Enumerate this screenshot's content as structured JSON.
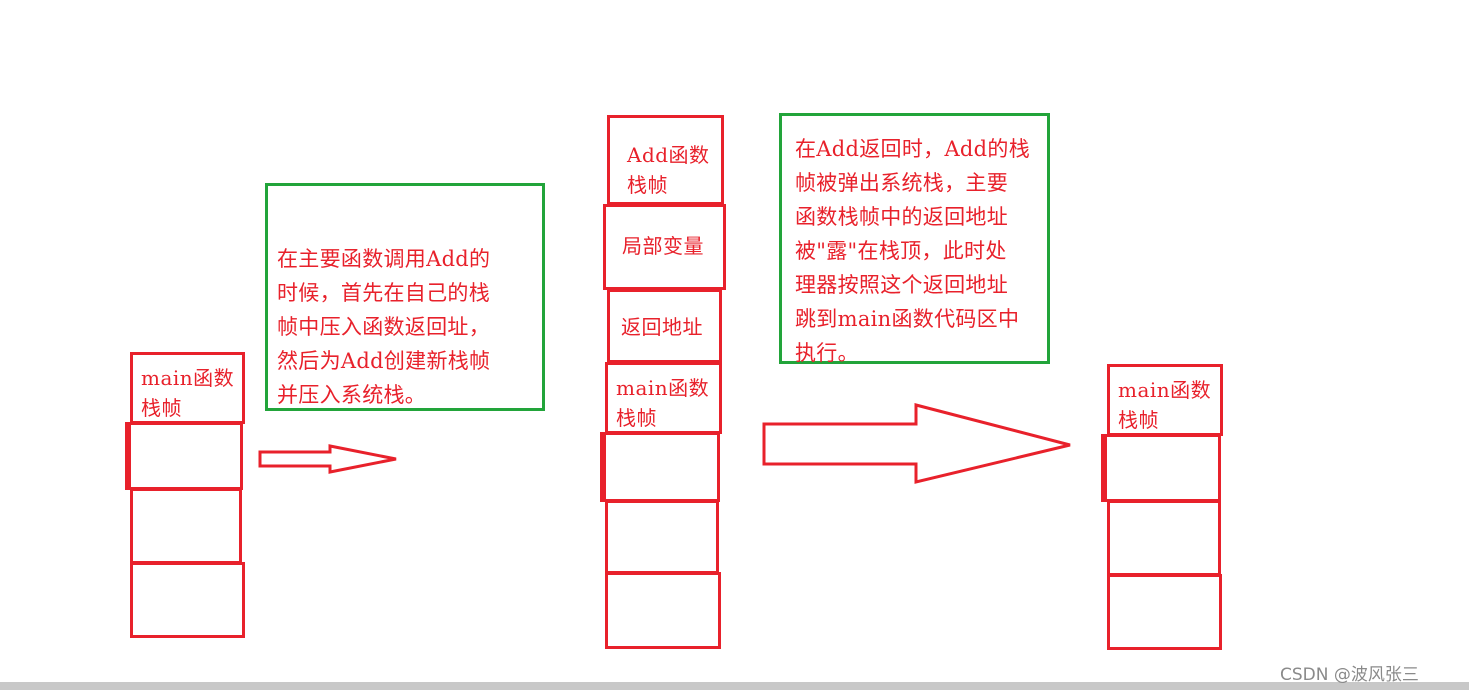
{
  "stack1": {
    "frame_label": "main函数\n栈帧"
  },
  "note1": {
    "text": "在主要函数调用Add的\n时候，首先在自己的栈\n帧中压入函数返回址，\n然后为Add创建新栈帧\n并压入系统栈。"
  },
  "stack2": {
    "add_label": "Add函数\n栈帧",
    "local_label": "局部变量",
    "return_label": "返回地址",
    "main_label": "main函数\n栈帧"
  },
  "note2": {
    "text": "在Add返回时，Add的栈\n帧被弹出系统栈，主要\n函数栈帧中的返回地址\n被\"露\"在栈顶，此时处\n理器按照这个返回地址\n跳到main函数代码区中\n执行。"
  },
  "stack3": {
    "frame_label": "main函数\n栈帧"
  },
  "watermark": "CSDN @波风张三",
  "colors": {
    "stroke_red": "#e8212b",
    "stroke_green": "#22a43a"
  }
}
